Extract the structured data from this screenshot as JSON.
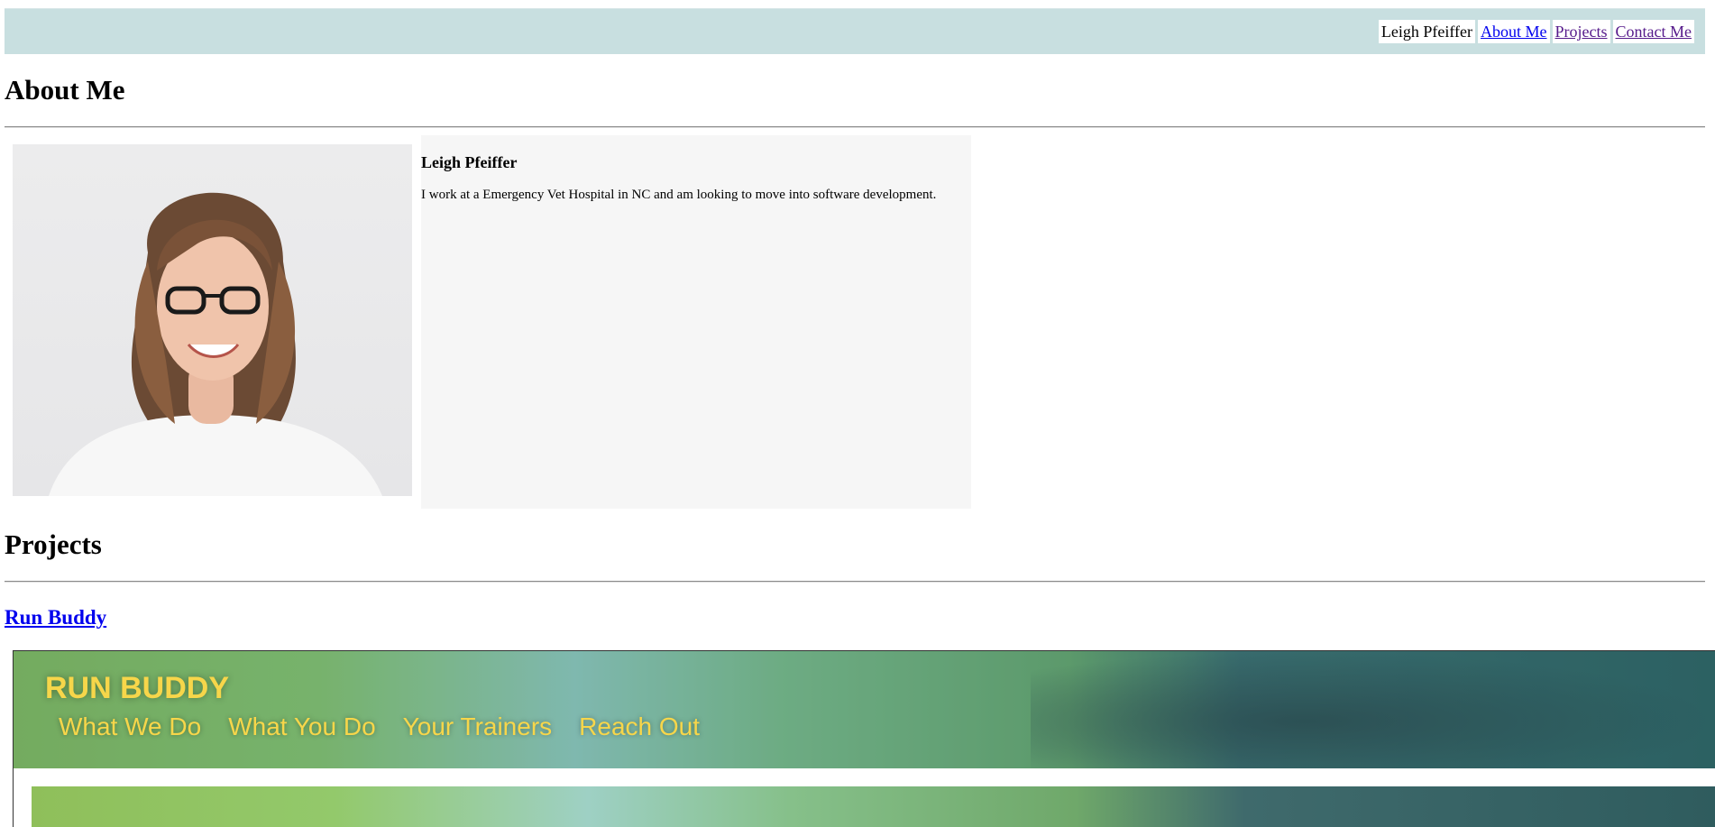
{
  "nav": {
    "name": "Leigh Pfeiffer",
    "links": [
      "About Me",
      "Projects",
      "Contact Me"
    ]
  },
  "about": {
    "heading": "About Me",
    "name": "Leigh Pfeiffer",
    "text": "I work at a Emergency Vet Hospital in NC and am looking to move into software development."
  },
  "projects": {
    "heading": "Projects",
    "items": [
      {
        "title": "Run Buddy",
        "preview": {
          "brand": "RUN BUDDY",
          "nav": [
            "What We Do",
            "What You Do",
            "Your Trainers",
            "Reach Out"
          ]
        }
      }
    ]
  },
  "colors": {
    "topbar": "#c8dfe0",
    "link": "#0000ee",
    "visited": "#551a8b",
    "brand_yellow": "#f7d64a"
  }
}
